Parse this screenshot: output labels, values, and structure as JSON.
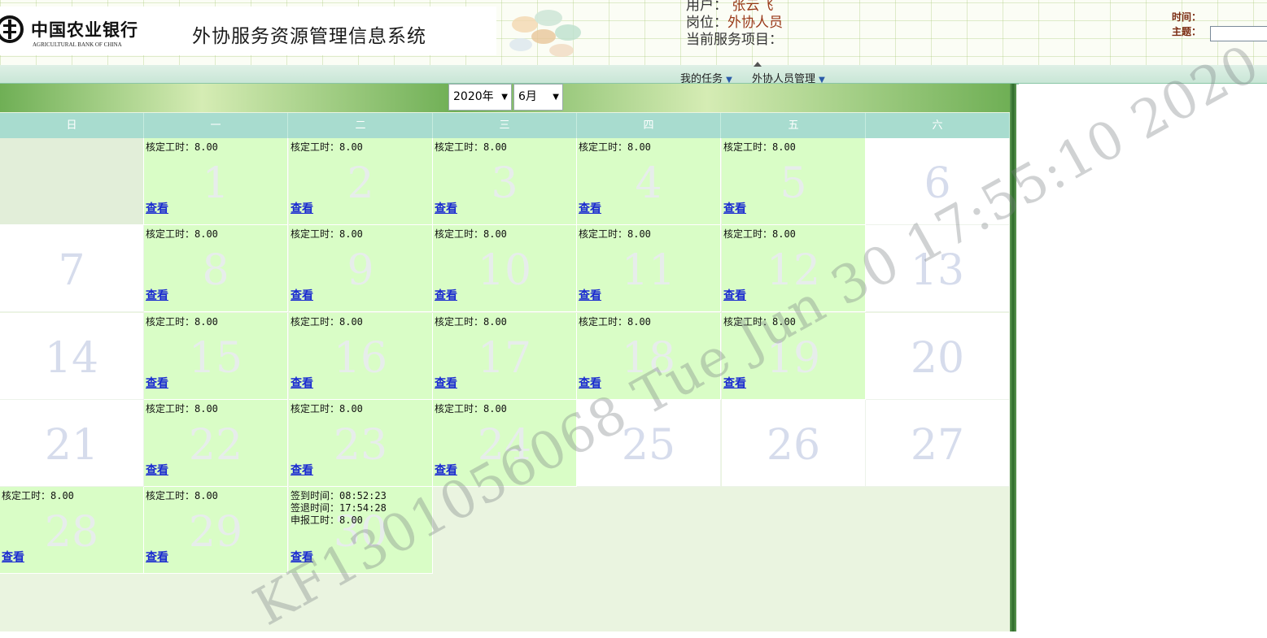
{
  "header": {
    "bank_name_cn": "中国农业银行",
    "bank_name_en": "AGRICULTURAL BANK OF CHINA",
    "system_title": "外协服务资源管理信息系统",
    "user_label": "用户：",
    "user_value": "张云飞",
    "post_label": "岗位：",
    "post_value": "外协人员",
    "project_label": "当前服务项目：",
    "time_label": "时间：",
    "topic_label": "主题："
  },
  "menu": {
    "items": [
      {
        "label": "我的任务"
      },
      {
        "label": "外协人员管理"
      }
    ]
  },
  "calendar": {
    "year_select": "2020年",
    "month_select": "6月",
    "weekdays": [
      "日",
      "一",
      "二",
      "三",
      "四",
      "五",
      "六"
    ],
    "view_label": "查看",
    "hours_label": "核定工时：8.00",
    "days": [
      {
        "n": "1",
        "info": "核定工时：8.00",
        "link": "查看",
        "work": true
      },
      {
        "n": "2",
        "info": "核定工时：8.00",
        "link": "查看",
        "work": true
      },
      {
        "n": "3",
        "info": "核定工时：8.00",
        "link": "查看",
        "work": true
      },
      {
        "n": "4",
        "info": "核定工时：8.00",
        "link": "查看",
        "work": true
      },
      {
        "n": "5",
        "info": "核定工时：8.00",
        "link": "查看",
        "work": true
      },
      {
        "n": "6",
        "info": "",
        "link": "",
        "work": false
      },
      {
        "n": "7",
        "info": "",
        "link": "",
        "work": false
      },
      {
        "n": "8",
        "info": "核定工时：8.00",
        "link": "查看",
        "work": true
      },
      {
        "n": "9",
        "info": "核定工时：8.00",
        "link": "查看",
        "work": true
      },
      {
        "n": "10",
        "info": "核定工时：8.00",
        "link": "查看",
        "work": true
      },
      {
        "n": "11",
        "info": "核定工时：8.00",
        "link": "查看",
        "work": true
      },
      {
        "n": "12",
        "info": "核定工时：8.00",
        "link": "查看",
        "work": true
      },
      {
        "n": "13",
        "info": "",
        "link": "",
        "work": false
      },
      {
        "n": "14",
        "info": "",
        "link": "",
        "work": false
      },
      {
        "n": "15",
        "info": "核定工时：8.00",
        "link": "查看",
        "work": true
      },
      {
        "n": "16",
        "info": "核定工时：8.00",
        "link": "查看",
        "work": true
      },
      {
        "n": "17",
        "info": "核定工时：8.00",
        "link": "查看",
        "work": true
      },
      {
        "n": "18",
        "info": "核定工时：8.00",
        "link": "查看",
        "work": true
      },
      {
        "n": "19",
        "info": "核定工时：8.00",
        "link": "查看",
        "work": true
      },
      {
        "n": "20",
        "info": "",
        "link": "",
        "work": false
      },
      {
        "n": "21",
        "info": "",
        "link": "",
        "work": false
      },
      {
        "n": "22",
        "info": "核定工时：8.00",
        "link": "查看",
        "work": true
      },
      {
        "n": "23",
        "info": "核定工时：8.00",
        "link": "查看",
        "work": true
      },
      {
        "n": "24",
        "info": "核定工时：8.00",
        "link": "查看",
        "work": true
      },
      {
        "n": "25",
        "info": "",
        "link": "",
        "work": false
      },
      {
        "n": "26",
        "info": "",
        "link": "",
        "work": false
      },
      {
        "n": "27",
        "info": "",
        "link": "",
        "work": false
      },
      {
        "n": "28",
        "info": "核定工时：8.00",
        "link": "查看",
        "work": true
      },
      {
        "n": "29",
        "info": "核定工时：8.00",
        "link": "查看",
        "work": true
      },
      {
        "n": "30",
        "info": "签到时间：08:52:23\n签退时间：17:54:28\n申报工时：8.00",
        "link": "查看",
        "work": true
      }
    ]
  },
  "watermark": "KF1301056068 Tue Jun 30 17:55:10 2020"
}
